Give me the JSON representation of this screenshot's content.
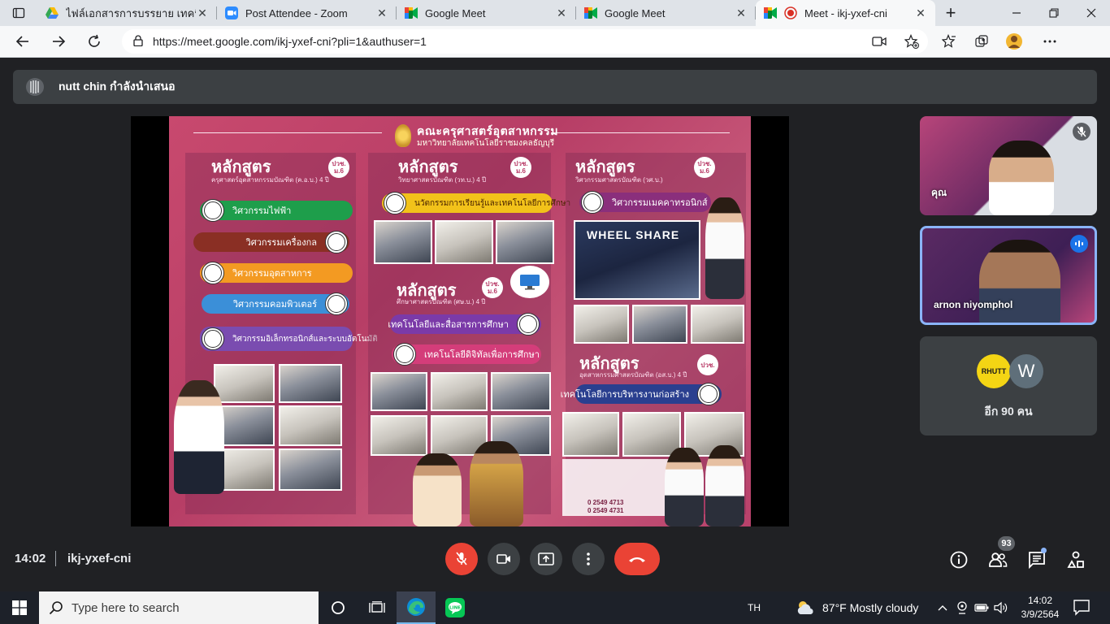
{
  "browser": {
    "tabs": [
      {
        "title": "ไฟล์เอกสารการบรรยาย เทคนิคการ",
        "active": false
      },
      {
        "title": "Post Attendee - Zoom",
        "active": false
      },
      {
        "title": "Google Meet",
        "active": false
      },
      {
        "title": "Google Meet",
        "active": false
      },
      {
        "title": "Meet - ikj-yxef-cni",
        "active": true
      }
    ],
    "url": "https://meet.google.com/ikj-yxef-cni?pli=1&authuser=1"
  },
  "banner": {
    "text": "nutt chin กำลังนำเสนอ"
  },
  "poster": {
    "title": "คณะครุศาสตร์อุตสาหกรรม",
    "subtitle": "มหาวิทยาลัยเทคโนโลยีราชมงคลธัญบุรี",
    "columns": [
      {
        "heading": "หลักสูตร",
        "subheading": "ครุศาสตร์อุตสาหกรรมบัณฑิต (ค.อ.บ.) 4 ปี",
        "badge": "ปวช. ม.6",
        "programs": [
          "วิศวกรรมไฟฟ้า",
          "วิศวกรรมเครื่องกล",
          "วิศวกรรมอุตสาหการ",
          "วิศวกรรมคอมพิวเตอร์",
          "วิศวกรรมอิเล็กทรอนิกส์และระบบอัตโนมัติ"
        ]
      },
      {
        "heading": "หลักสูตร",
        "subheading": "วิทยาศาสตรบัณฑิต (วท.บ.) 4 ปี",
        "badge": "ปวช. ม.6",
        "programs": [
          "นวัตกรรมการเรียนรู้และเทคโนโลยีการศึกษา"
        ]
      },
      {
        "heading": "หลักสูตร",
        "subheading": "ศึกษาศาสตรบัณฑิต (ศษ.บ.) 4 ปี",
        "badge": "ปวช. ม.6",
        "programs": [
          "เทคโนโลยีและสื่อสารการศึกษา",
          "เทคโนโลยีดิจิทัลเพื่อการศึกษา"
        ]
      },
      {
        "heading": "หลักสูตร",
        "subheading": "วิศวกรรมศาสตรบัณฑิต (วศ.บ.)",
        "badge": "ปวช. ม.6",
        "programs": [
          "วิศวกรรมเมคคาทรอนิกส์"
        ]
      },
      {
        "heading": "หลักสูตร",
        "subheading": "อุตสาหกรรมศาสตรบัณฑิต (อส.บ.) 4 ปี",
        "badge": "ปวช.",
        "programs": [
          "เทคโนโลยีการบริหารงานก่อสร้าง"
        ]
      }
    ],
    "wheel_label": "WHEEL SHARE",
    "phones": [
      "0 2549 4713",
      "0 2549 4731"
    ]
  },
  "participants": [
    {
      "name": "คุณ",
      "muted": true
    },
    {
      "name": "arnon niyomphol",
      "speaking": true
    }
  ],
  "more_participants": {
    "avatars": [
      "RHUTT",
      "W"
    ],
    "label": "อีก 90 คน"
  },
  "meeting": {
    "time": "14:02",
    "code": "ikj-yxef-cni",
    "people_count": "93"
  },
  "taskbar": {
    "search_placeholder": "Type here to search",
    "language": "TH",
    "weather": "87°F  Mostly cloudy",
    "clock_time": "14:02",
    "clock_date": "3/9/2564"
  },
  "colors": {
    "meet_bg": "#202124",
    "tile_bg": "#3c4043",
    "mic_red": "#ea4335",
    "speaking_blue": "#8ab4f8",
    "poster_pink": "#c8496e"
  }
}
